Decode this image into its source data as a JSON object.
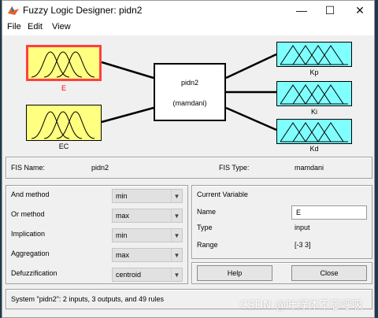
{
  "window": {
    "title": "Fuzzy Logic Designer: pidn2",
    "minimize": "—",
    "maximize": "☐",
    "close": "✕"
  },
  "menu": [
    "File",
    "Edit",
    "View"
  ],
  "diagram": {
    "inputs": [
      {
        "name": "E",
        "color": "#ffff80",
        "selected": true,
        "label_color": "#ff0000"
      },
      {
        "name": "EC",
        "color": "#ffff80",
        "selected": false,
        "label_color": "#000000"
      }
    ],
    "fis": {
      "name": "pidn2",
      "type": "(mamdani)"
    },
    "outputs": [
      {
        "name": "Kp",
        "color": "#80ffff"
      },
      {
        "name": "Ki",
        "color": "#80ffff"
      },
      {
        "name": "Kd",
        "color": "#80ffff"
      }
    ]
  },
  "fis_info": {
    "name_label": "FIS Name:",
    "name_value": "pidn2",
    "type_label": "FIS Type:",
    "type_value": "mamdani"
  },
  "methods": [
    {
      "label": "And method",
      "value": "min"
    },
    {
      "label": "Or method",
      "value": "max"
    },
    {
      "label": "Implication",
      "value": "min"
    },
    {
      "label": "Aggregation",
      "value": "max"
    },
    {
      "label": "Defuzzification",
      "value": "centroid"
    }
  ],
  "current_variable": {
    "heading": "Current Variable",
    "name_label": "Name",
    "name_value": "E",
    "type_label": "Type",
    "type_value": "input",
    "range_label": "Range",
    "range_value": "[-3 3]"
  },
  "buttons": {
    "help": "Help",
    "close": "Close"
  },
  "status": "System \"pidn2\": 2 inputs, 3 outputs, and 49 rules",
  "watermark": "CSDN @叶绿体不忘呼吸"
}
